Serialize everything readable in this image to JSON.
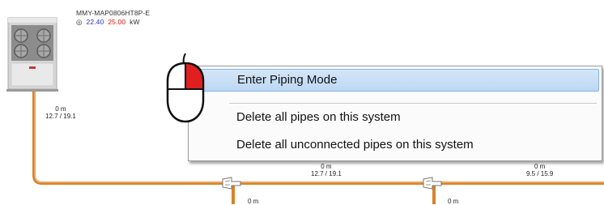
{
  "outdoor_unit": {
    "model": "MMY-MAP0806HT8P-E",
    "cooling_capacity": "22.40",
    "heating_capacity": "25.00",
    "unit": "kW"
  },
  "pipes": [
    {
      "length": "0 m",
      "size": "12.7 / 19.1"
    },
    {
      "length": "0 m",
      "size": "12.7 / 19.1"
    },
    {
      "length": "0 m",
      "size": "9.5 / 15.9"
    },
    {
      "length": "0 m"
    },
    {
      "length": "0 m"
    }
  ],
  "context_menu": {
    "items": [
      {
        "label": "Enter Piping Mode"
      },
      {
        "label": "Delete all pipes on this system"
      },
      {
        "label": "Delete all unconnected pipes on this system"
      }
    ]
  },
  "colors": {
    "pipe": "#d9822b",
    "cooling_text": "#2233cc",
    "heating_text": "#dd1111",
    "menu_highlight": "#bdd8f3",
    "mouse_button": "#e02020"
  },
  "icons": [
    "outdoor-unit-icon",
    "mouse-icon",
    "pipe-joint-icon"
  ]
}
